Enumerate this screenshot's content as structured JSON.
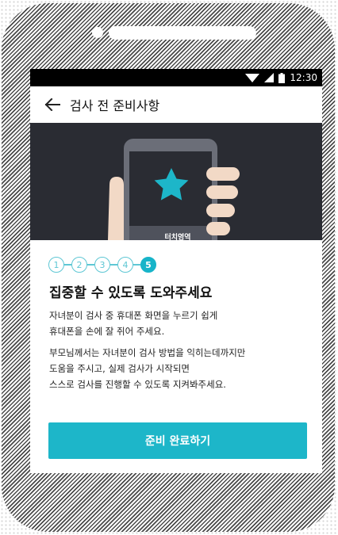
{
  "status_bar": {
    "time": "12:30",
    "icons": [
      "wifi-icon",
      "signal-icon",
      "battery-icon"
    ]
  },
  "app_bar": {
    "back_icon": "arrow-left-icon",
    "title": "검사 전 준비사항"
  },
  "hero": {
    "touch_area_label": "터치영역",
    "icon": "star-icon",
    "colors": {
      "background": "#2a2c33",
      "star": "#1db6c9",
      "hand": "#f2d9c6"
    }
  },
  "steps": {
    "items": [
      "1",
      "2",
      "3",
      "4",
      "5"
    ],
    "current": 5
  },
  "content": {
    "heading": "집중할 수 있도록 도와주세요",
    "paragraph_1": "자녀분이 검사 중 휴대폰 화면을 누르기 쉽게\n휴대폰을 손에 잘 쥐어 주세요.",
    "paragraph_2": "부모님께서는 자녀분이 검사 방법을 익히는데까지만\n도움을 주시고, 실제 검사가 시작되면\n스스로 검사를 진행할 수 있도록 지켜봐주세요."
  },
  "cta": {
    "label": "준비 완료하기",
    "color": "#1db6c9"
  }
}
